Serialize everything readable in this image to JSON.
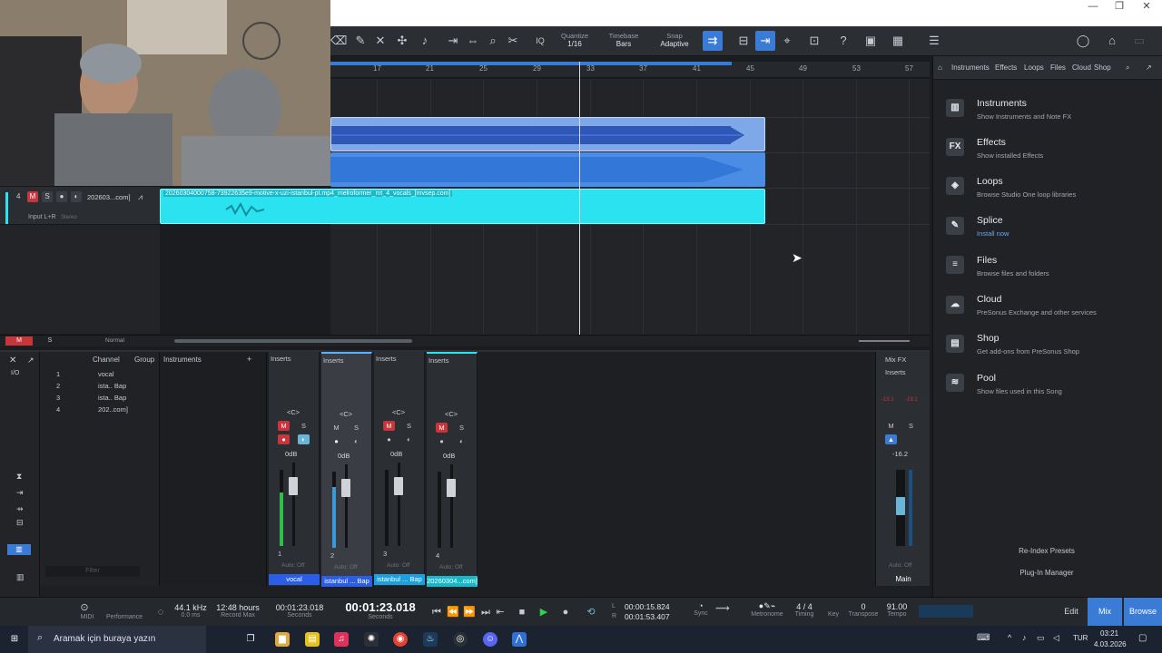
{
  "arrange": {
    "ruler_marks": [
      "17",
      "21",
      "25",
      "29",
      "33",
      "37",
      "41",
      "45",
      "49",
      "53",
      "57"
    ],
    "vocal_clip_name": "20260304000758-73922635e9-motive-x-uzi-istanbul-pt.mp4_melroformer_mt_4_vocals_[mvsep.com]"
  },
  "toolbar": {
    "quantize_label": "Quantize",
    "quantize_value": "1/16",
    "timebase_label": "Timebase",
    "timebase_value": "Bars",
    "snap_label": "Snap",
    "snap_value": "Adaptive",
    "iq": "IQ"
  },
  "track": {
    "number": "4",
    "m": "M",
    "s": "S",
    "name": "202603...com]",
    "input": "Input L+R",
    "input_mode": "Stereo"
  },
  "footer_track": {
    "m": "M",
    "s": "S",
    "mode": "Normal"
  },
  "browser": {
    "tabs": [
      "Instruments",
      "Effects",
      "Loops",
      "Files",
      "Cloud",
      "Shop"
    ],
    "items": [
      {
        "icon": "piano-icon",
        "glyph": "▥",
        "title": "Instruments",
        "desc": "Show Instruments and Note FX"
      },
      {
        "icon": "fx-icon",
        "glyph": "FX",
        "title": "Effects",
        "desc": "Show installed Effects"
      },
      {
        "icon": "loops-icon",
        "glyph": "◈",
        "title": "Loops",
        "desc": "Browse Studio One loop libraries"
      },
      {
        "icon": "splice-icon",
        "glyph": "✎",
        "title": "Splice",
        "desc": "Install now"
      },
      {
        "icon": "files-icon",
        "glyph": "≡",
        "title": "Files",
        "desc": "Browse files and folders"
      },
      {
        "icon": "cloud-icon",
        "glyph": "☁",
        "title": "Cloud",
        "desc": "PreSonus Exchange and other services"
      },
      {
        "icon": "shop-icon",
        "glyph": "▤",
        "title": "Shop",
        "desc": "Get add-ons from PreSonus Shop"
      },
      {
        "icon": "pool-icon",
        "glyph": "≋",
        "title": "Pool",
        "desc": "Show files used in this Song"
      }
    ],
    "reindex": "Re-Index Presets",
    "plugin_manager": "Plug-In Manager"
  },
  "mixer": {
    "channel_label": "Channel",
    "group_label": "Group",
    "instruments_label": "Instruments",
    "io_label": "I/O",
    "list": [
      {
        "num": "1",
        "name": "vocal"
      },
      {
        "num": "2",
        "name": "ista.. Bap"
      },
      {
        "num": "3",
        "name": "ista.. Bap"
      },
      {
        "num": "4",
        "name": "202..com]"
      }
    ],
    "filter_placeholder": "Filter",
    "strips": [
      {
        "inserts": "Inserts",
        "center": "<C>",
        "m": "M",
        "s": "S",
        "db": "0dB",
        "num": "1",
        "auto": "Auto: Off",
        "name": "vocal",
        "color": "#2a5ee8",
        "level": 0.7
      },
      {
        "inserts": "Inserts",
        "center": "<C>",
        "m": "M",
        "s": "S",
        "db": "0dB",
        "num": "2",
        "auto": "Auto: Off",
        "name": "istanbul ... Bap",
        "color": "#2a5ee8",
        "level": 0.8
      },
      {
        "inserts": "Inserts",
        "center": "<C>",
        "m": "M",
        "s": "S",
        "db": "0dB",
        "num": "3",
        "auto": "Auto: Off",
        "name": "istanbul ... Bap",
        "color": "#1c9fe0",
        "level": 0.0
      },
      {
        "inserts": "Inserts",
        "center": "<C>",
        "m": "M",
        "s": "S",
        "db": "0dB",
        "num": "4",
        "auto": "Auto: Off",
        "name": "20260304...com]",
        "color": "#17b9c9",
        "level": 0.0
      }
    ],
    "main": {
      "fx": "Mix FX",
      "inserts": "Inserts",
      "peak_l": "-19.1",
      "peak_r": "-19.1",
      "m": "M",
      "s": "S",
      "db": "-16.2",
      "auto": "Auto: Off",
      "name": "Main"
    }
  },
  "transport": {
    "midi": "MIDI",
    "performance": "Performance",
    "sample_rate": "44.1 kHz",
    "latency": "0.0 ms",
    "record_max_value": "12:48 hours",
    "record_max_label": "Record Max",
    "seconds_small": "00:01:23.018",
    "seconds_small_label": "Seconds",
    "main_time": "00:01:23.018",
    "main_time_label": "Seconds",
    "loop_l": "00:00:15.824",
    "loop_r": "00:01:53.407",
    "l": "L",
    "r": "R",
    "sync": "Sync",
    "metronome": "Metronome",
    "timing_value": "4 / 4",
    "timing_label": "Timing",
    "key_label": "Key",
    "transpose_value": "0",
    "transpose_label": "Transpose",
    "tempo_value": "91.00",
    "tempo_label": "Tempo",
    "pages": [
      "Edit",
      "Mix",
      "Browse"
    ]
  },
  "taskbar": {
    "search_placeholder": "Aramak için buraya yazın",
    "lang": "TUR",
    "time": "03:21",
    "date": "4.03.2026"
  },
  "colors": {
    "accent": "#3a7bd5",
    "vocal_clip": "#2be3f0",
    "mute_red": "#c8353a"
  }
}
